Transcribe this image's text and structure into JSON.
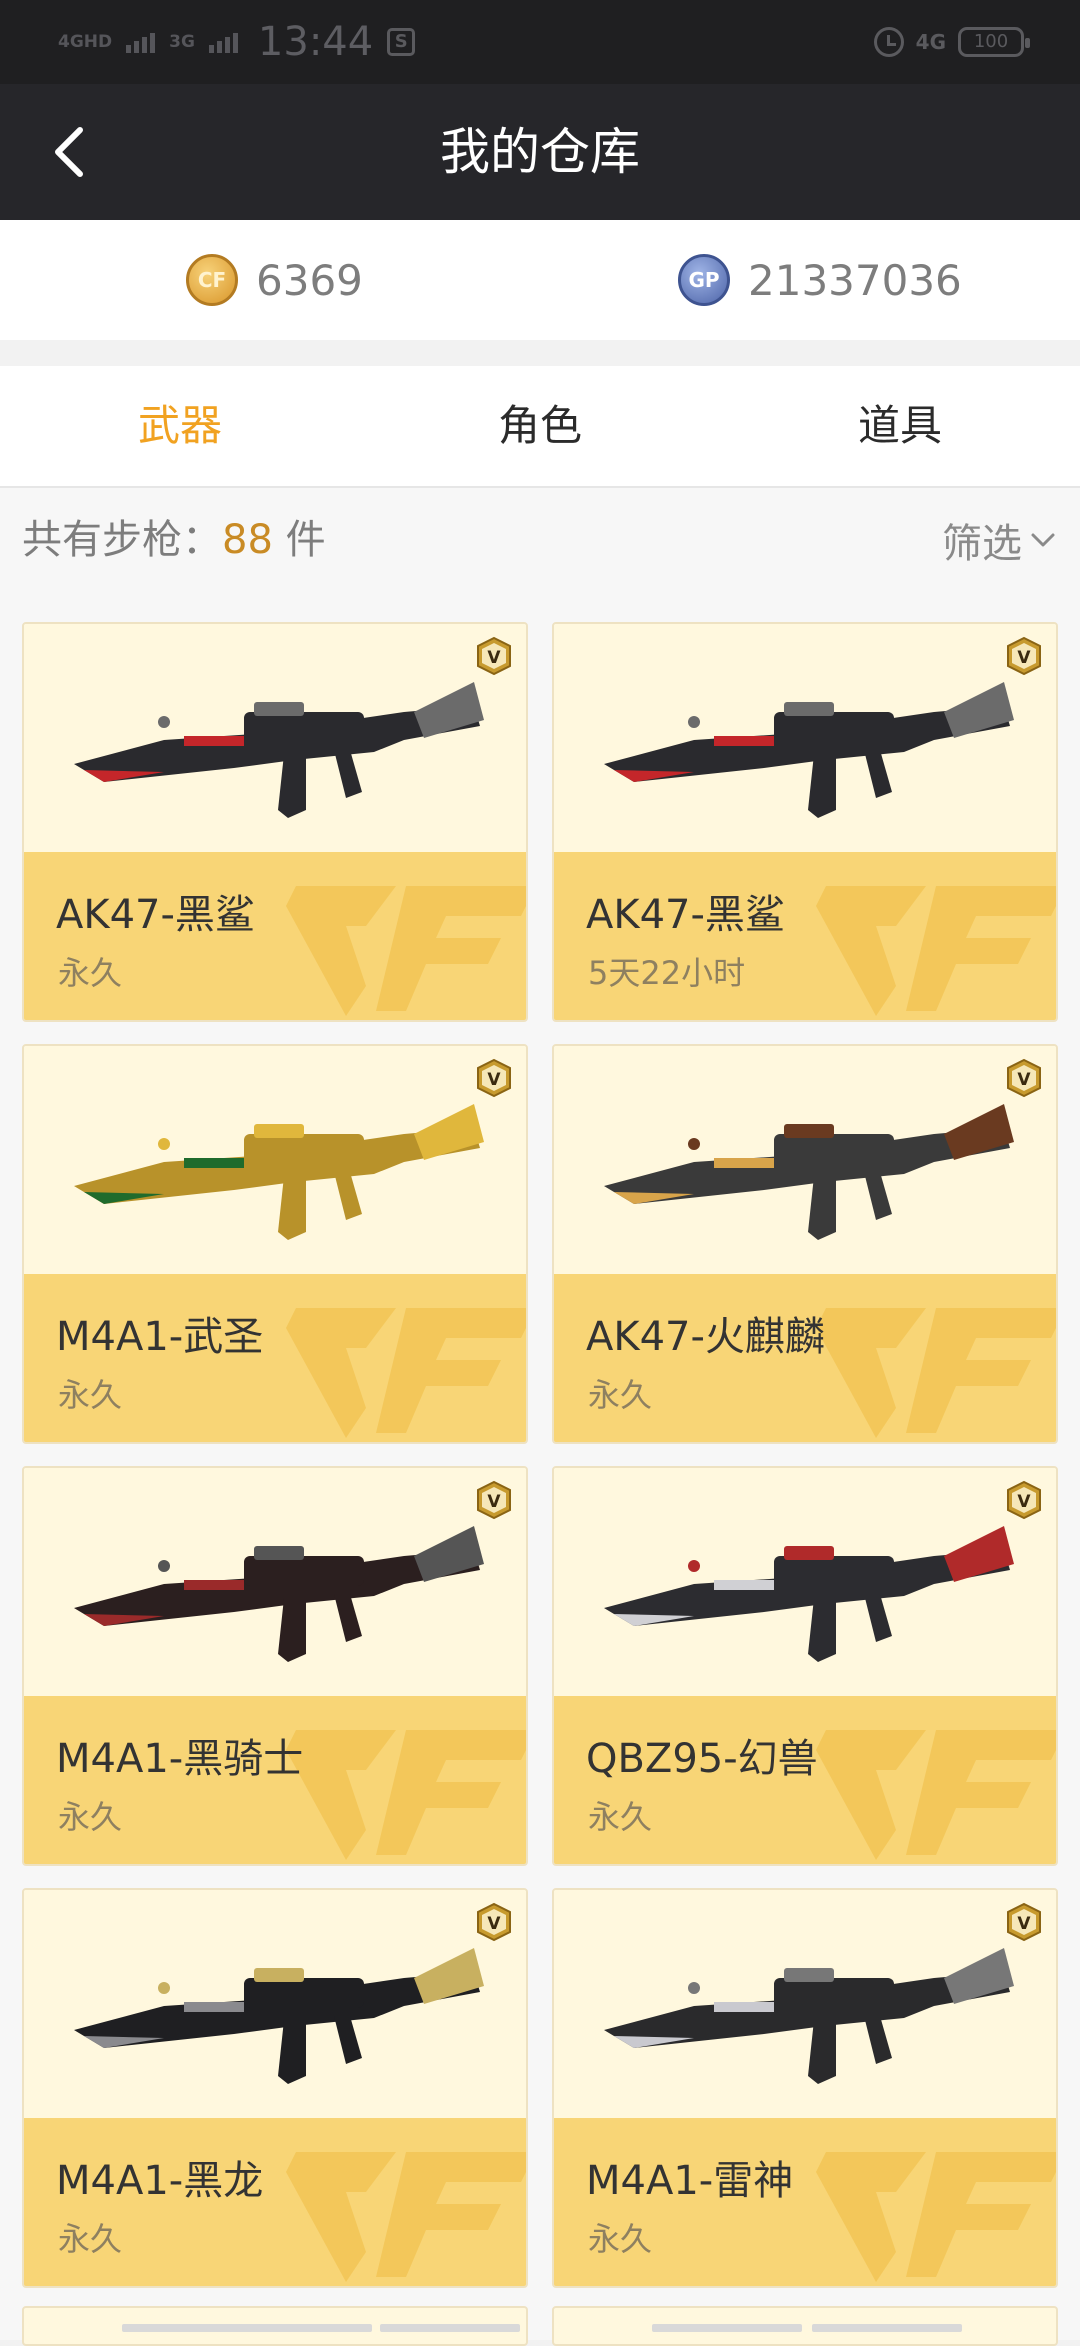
{
  "status_bar": {
    "net1": "4GHD",
    "net2": "3G",
    "time": "13:44",
    "net_right": "4G",
    "battery": "100"
  },
  "nav": {
    "title": "我的仓库"
  },
  "currency": {
    "cf_points": "6369",
    "gp": "21337036",
    "cf_icon_text": "CF",
    "gp_icon_text": "GP"
  },
  "tabs": [
    "武器",
    "角色",
    "道具"
  ],
  "info": {
    "prefix": "共有步枪：",
    "count": "88",
    "suffix": " 件",
    "filter_label": "筛选"
  },
  "items": [
    {
      "name": "AK47-黑鲨",
      "duration": "永久",
      "icon": "rifle-ak47-black-shark"
    },
    {
      "name": "AK47-黑鲨",
      "duration": "5天22小时",
      "icon": "rifle-ak47-black-shark"
    },
    {
      "name": "M4A1-武圣",
      "duration": "永久",
      "icon": "rifle-m4a1-gold-dragon"
    },
    {
      "name": "AK47-火麒麟",
      "duration": "永久",
      "icon": "rifle-ak47-fire-qilin"
    },
    {
      "name": "M4A1-黑骑士",
      "duration": "永久",
      "icon": "rifle-m4a1-black-knight"
    },
    {
      "name": "QBZ95-幻兽",
      "duration": "永久",
      "icon": "rifle-qbz95-phantom-beast"
    },
    {
      "name": "M4A1-黑龙",
      "duration": "永久",
      "icon": "rifle-m4a1-black-dragon"
    },
    {
      "name": "M4A1-雷神",
      "duration": "永久",
      "icon": "rifle-m4a1-thor"
    }
  ],
  "colors": {
    "accent": "#f1a221",
    "card_footer": "#f8d576",
    "card_bg": "#fff8de",
    "navbar": "#26262a"
  }
}
